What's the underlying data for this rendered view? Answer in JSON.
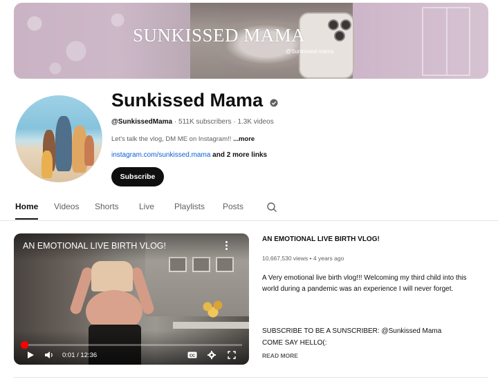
{
  "banner": {
    "title": "SUNKISSED MAMA",
    "handle": "@Sunkissed.mama"
  },
  "channel": {
    "name": "Sunkissed Mama",
    "handle": "@SunkissedMama",
    "subscribers": "511K subscribers",
    "videos": "1.3K videos",
    "description": "Let's talk the vlog, DM ME on Instagram!!",
    "more_label": "...more",
    "link": "instagram.com/sunkissed.mama",
    "more_links": "and 2 more links",
    "subscribe_label": "Subscribe"
  },
  "tabs": [
    {
      "label": "Home",
      "active": true
    },
    {
      "label": "Videos"
    },
    {
      "label": "Shorts"
    },
    {
      "label": "Live"
    },
    {
      "label": "Playlists"
    },
    {
      "label": "Posts"
    }
  ],
  "search_icon": "search-icon",
  "featured_video": {
    "overlay_title": "AN EMOTIONAL LIVE BIRTH VLOG!",
    "title": "AN EMOTIONAL LIVE BIRTH VLOG!",
    "views": "10,667,530 views",
    "age": "4 years ago",
    "description": "A Very emotional live birth vlog!!! Welcoming my third child into this world during a pandemic was an experience I will never forget.",
    "subscribe_line": "SUBSCRIBE TO BE A SUNSCRIBER: @Sunkissed Mama",
    "hello_line": "COME SAY HELLO(:",
    "read_more": "READ MORE",
    "time": "0:01 / 12:36",
    "progress_fraction": 0.0013
  },
  "colors": {
    "accent_red": "#ff0000",
    "link_blue": "#065fd4",
    "banner_pink": "#cdb6c9"
  }
}
